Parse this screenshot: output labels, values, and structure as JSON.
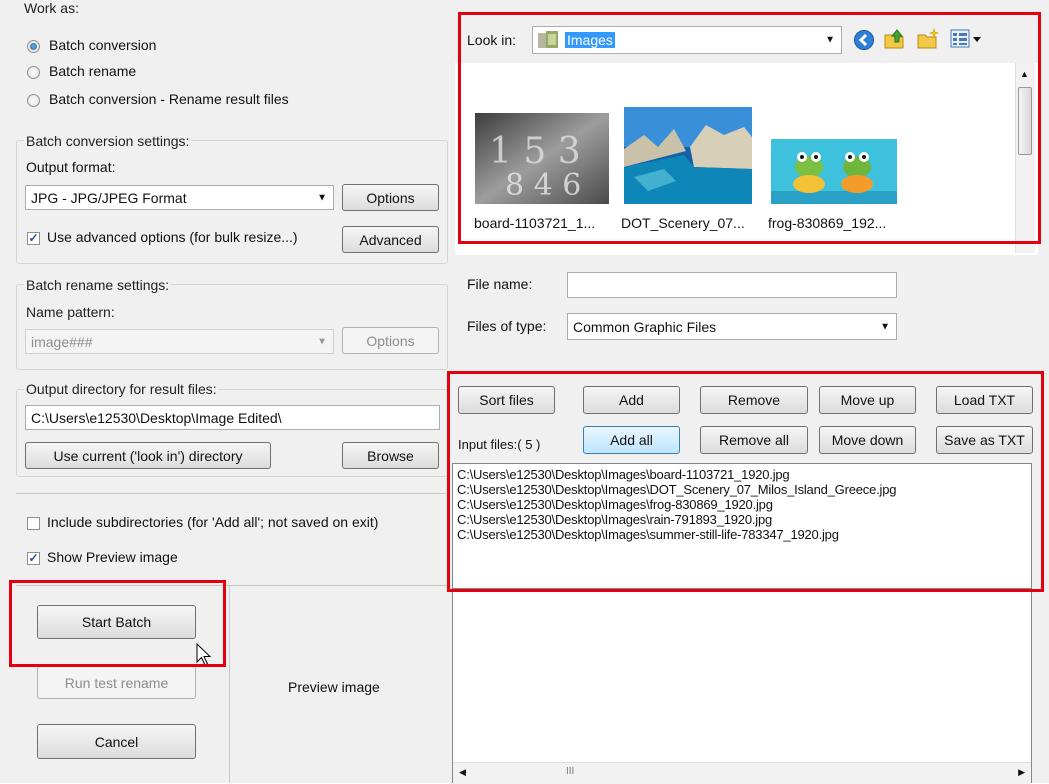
{
  "work_as": {
    "title": "Work as:",
    "options": [
      {
        "label": "Batch conversion",
        "selected": true
      },
      {
        "label": "Batch rename",
        "selected": false
      },
      {
        "label": "Batch conversion - Rename result files",
        "selected": false
      }
    ]
  },
  "batch_conversion": {
    "title": "Batch conversion settings:",
    "output_format_label": "Output format:",
    "output_format_value": "JPG - JPG/JPEG Format",
    "options_button": "Options",
    "advanced_checkbox_label": "Use advanced options (for bulk resize...)",
    "advanced_checked": true,
    "advanced_button": "Advanced"
  },
  "batch_rename": {
    "title": "Batch rename settings:",
    "name_pattern_label": "Name pattern:",
    "name_pattern_value": "image###",
    "options_button": "Options"
  },
  "output_dir": {
    "title": "Output directory for result files:",
    "path": "C:\\Users\\e12530\\Desktop\\Image Edited\\",
    "use_current_button": "Use current ('look in') directory",
    "browse_button": "Browse"
  },
  "checks": {
    "include_subdirs_label": "Include subdirectories (for 'Add all'; not saved on exit)",
    "include_subdirs_checked": false,
    "show_preview_label": "Show Preview image",
    "show_preview_checked": true
  },
  "actions": {
    "start_batch": "Start Batch",
    "run_test_rename": "Run test rename",
    "cancel": "Cancel",
    "preview_label": "Preview image"
  },
  "browser": {
    "look_in_label": "Look in:",
    "look_in_value": "Images",
    "thumbnails": [
      {
        "name": "board-1103721_1..."
      },
      {
        "name": "DOT_Scenery_07..."
      },
      {
        "name": "frog-830869_192..."
      }
    ],
    "file_name_label": "File name:",
    "file_name_value": "",
    "files_of_type_label": "Files of type:",
    "files_of_type_value": "Common Graphic Files"
  },
  "file_list": {
    "buttons": {
      "sort": "Sort files",
      "add": "Add",
      "remove": "Remove",
      "move_up": "Move up",
      "load_txt": "Load TXT",
      "add_all": "Add all",
      "remove_all": "Remove all",
      "move_down": "Move down",
      "save_txt": "Save as TXT"
    },
    "input_files_label": "Input files:( 5 )",
    "files": [
      "C:\\Users\\e12530\\Desktop\\Images\\board-1103721_1920.jpg",
      "C:\\Users\\e12530\\Desktop\\Images\\DOT_Scenery_07_Milos_Island_Greece.jpg",
      "C:\\Users\\e12530\\Desktop\\Images\\frog-830869_1920.jpg",
      "C:\\Users\\e12530\\Desktop\\Images\\rain-791893_1920.jpg",
      "C:\\Users\\e12530\\Desktop\\Images\\summer-still-life-783347_1920.jpg"
    ]
  },
  "scrollbar_grip": "III",
  "colors": {
    "highlight": "#e4000f",
    "selection": "#3399ff"
  }
}
